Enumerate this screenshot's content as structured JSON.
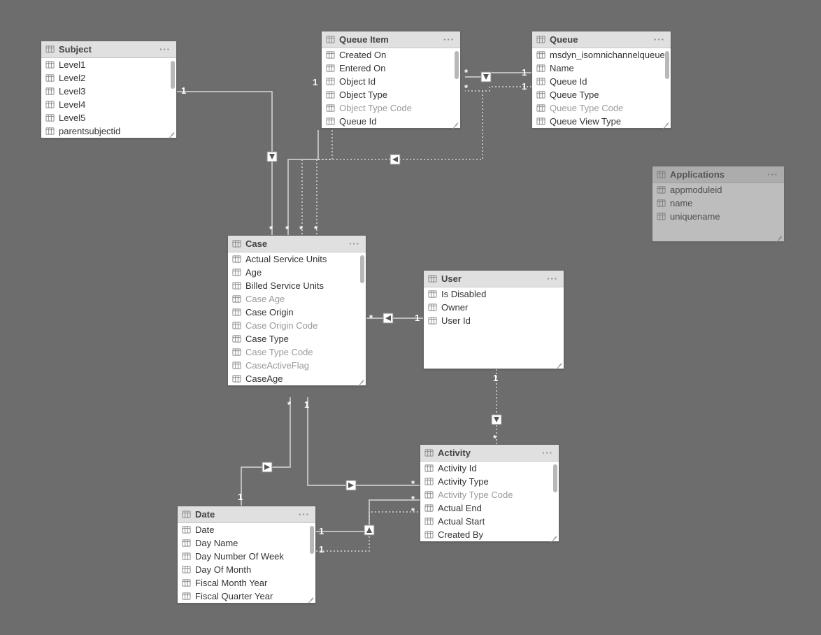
{
  "entities": {
    "subject": {
      "title": "Subject",
      "fields": [
        {
          "label": "Level1"
        },
        {
          "label": "Level2"
        },
        {
          "label": "Level3"
        },
        {
          "label": "Level4"
        },
        {
          "label": "Level5"
        },
        {
          "label": "parentsubjectid"
        }
      ]
    },
    "queueitem": {
      "title": "Queue Item",
      "fields": [
        {
          "label": "Created On"
        },
        {
          "label": "Entered On"
        },
        {
          "label": "Object Id"
        },
        {
          "label": "Object Type"
        },
        {
          "label": "Object Type Code",
          "dim": true
        },
        {
          "label": "Queue Id"
        }
      ]
    },
    "queue": {
      "title": "Queue",
      "fields": [
        {
          "label": "msdyn_isomnichannelqueue"
        },
        {
          "label": "Name"
        },
        {
          "label": "Queue Id"
        },
        {
          "label": "Queue Type"
        },
        {
          "label": "Queue Type Code",
          "dim": true
        },
        {
          "label": "Queue View Type"
        }
      ]
    },
    "applications": {
      "title": "Applications",
      "fields": [
        {
          "label": "appmoduleid"
        },
        {
          "label": "name"
        },
        {
          "label": "uniquename"
        }
      ]
    },
    "case": {
      "title": "Case",
      "fields": [
        {
          "label": "Actual Service Units"
        },
        {
          "label": "Age"
        },
        {
          "label": "Billed Service Units"
        },
        {
          "label": "Case Age",
          "dim": true
        },
        {
          "label": "Case Origin"
        },
        {
          "label": "Case Origin Code",
          "dim": true
        },
        {
          "label": "Case Type"
        },
        {
          "label": "Case Type Code",
          "dim": true
        },
        {
          "label": "CaseActiveFlag",
          "dim": true
        },
        {
          "label": "CaseAge"
        }
      ]
    },
    "user": {
      "title": "User",
      "fields": [
        {
          "label": "Is Disabled"
        },
        {
          "label": "Owner"
        },
        {
          "label": "User Id"
        }
      ]
    },
    "activity": {
      "title": "Activity",
      "fields": [
        {
          "label": "Activity Id"
        },
        {
          "label": "Activity Type"
        },
        {
          "label": "Activity Type Code",
          "dim": true
        },
        {
          "label": "Actual End"
        },
        {
          "label": "Actual Start"
        },
        {
          "label": "Created By"
        }
      ]
    },
    "date": {
      "title": "Date",
      "fields": [
        {
          "label": "Date"
        },
        {
          "label": "Day Name"
        },
        {
          "label": "Day Number Of Week"
        },
        {
          "label": "Day Of Month"
        },
        {
          "label": "Fiscal Month Year"
        },
        {
          "label": "Fiscal Quarter Year"
        }
      ]
    }
  },
  "menu_label": "···",
  "cardinality": {
    "one": "1",
    "many": "*"
  },
  "relationships": [
    {
      "from": "Subject",
      "to": "Case",
      "from_card": "1",
      "to_card": "*",
      "style": "solid"
    },
    {
      "from": "Queue Item",
      "to": "Case",
      "from_card": "1",
      "to_card": "*",
      "style": "solid"
    },
    {
      "from": "Queue Item",
      "to": "Case",
      "from_card": "1",
      "to_card": "*",
      "style": "dotted"
    },
    {
      "from": "Queue",
      "to": "Queue Item",
      "from_card": "1",
      "to_card": "*",
      "style": "solid"
    },
    {
      "from": "Queue",
      "to": "Queue Item",
      "from_card": "1",
      "to_card": "*",
      "style": "dotted"
    },
    {
      "from": "Queue",
      "to": "Case",
      "from_card": "1",
      "to_card": "*",
      "style": "dotted"
    },
    {
      "from": "User",
      "to": "Case",
      "from_card": "1",
      "to_card": "*",
      "style": "solid"
    },
    {
      "from": "User",
      "to": "Activity",
      "from_card": "1",
      "to_card": "*",
      "style": "dotted"
    },
    {
      "from": "Case",
      "to": "Activity",
      "from_card": "1",
      "to_card": "*",
      "style": "solid"
    },
    {
      "from": "Date",
      "to": "Case",
      "from_card": "1",
      "to_card": "*",
      "style": "solid"
    },
    {
      "from": "Date",
      "to": "Activity",
      "from_card": "1",
      "to_card": "*",
      "style": "solid"
    },
    {
      "from": "Date",
      "to": "Activity",
      "from_card": "1",
      "to_card": "*",
      "style": "dotted"
    }
  ]
}
